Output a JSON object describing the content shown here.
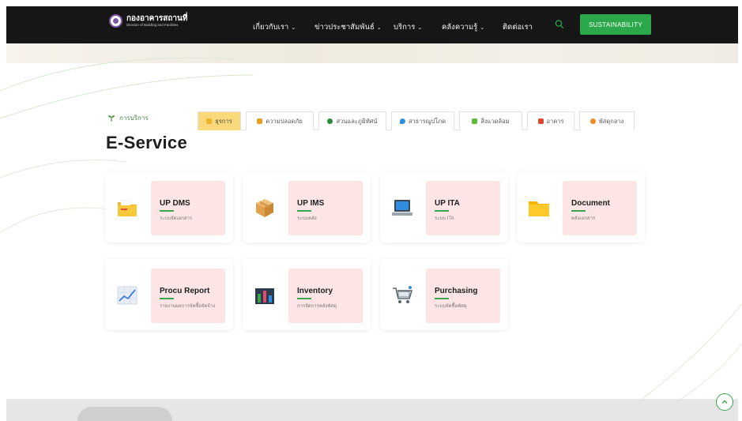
{
  "header": {
    "logo_main": "กองอาคารสถานที่",
    "logo_sub": "Division of Building and Facilities",
    "nav": [
      {
        "label": "เกี่ยวกับเรา",
        "has_dropdown": true
      },
      {
        "label": "ข่าวประชาสัมพันธ์",
        "has_dropdown": true
      },
      {
        "label": "บริการ",
        "has_dropdown": true
      },
      {
        "label": "คลังความรู้",
        "has_dropdown": true
      },
      {
        "label": "ติดต่อเรา",
        "has_dropdown": false
      }
    ],
    "search_icon": "search-icon",
    "sustainability_label": "SUSTAINABILITY",
    "accent_color": "#2aa84a"
  },
  "section": {
    "label": "การบริการ",
    "title": "E-Service"
  },
  "tabs": [
    {
      "label": "ธุรการ",
      "active": true,
      "icon_color": "#f0b429"
    },
    {
      "label": "ความปลอดภัย",
      "active": false,
      "icon_color": "#e8a020"
    },
    {
      "label": "สวนและภูมิทัศน์",
      "active": false,
      "icon_color": "#2e8b3a"
    },
    {
      "label": "สาธารณูปโภค",
      "active": false,
      "icon_color": "#2f8ee0"
    },
    {
      "label": "สิ่งแวดล้อม",
      "active": false,
      "icon_color": "#5dbb3a"
    },
    {
      "label": "อาคาร",
      "active": false,
      "icon_color": "#e0452f"
    },
    {
      "label": "พัสดุกลาง",
      "active": false,
      "icon_color": "#f08a24"
    }
  ],
  "services": [
    {
      "title": "UP DMS",
      "subtitle": "ระบบจัดเอกสาร",
      "icon": "folder-icon"
    },
    {
      "title": "UP IMS",
      "subtitle": "ระบบคลัง",
      "icon": "box-icon"
    },
    {
      "title": "UP ITA",
      "subtitle": "ระบบ ITA",
      "icon": "laptop-icon"
    },
    {
      "title": "Document",
      "subtitle": "คลังเอกสาร",
      "icon": "document-folder-icon"
    },
    {
      "title": "Procu Report",
      "subtitle": "รายงานผลการจัดซื้อจัดจ้าง",
      "icon": "chart-report-icon"
    },
    {
      "title": "Inventory",
      "subtitle": "การจัดการคลังพัสดุ",
      "icon": "bar-chart-icon"
    },
    {
      "title": "Purchasing",
      "subtitle": "ระบบจัดซื้อพัสดุ",
      "icon": "shopping-cart-icon"
    }
  ],
  "back_to_top_icon": "chevron-up-icon"
}
